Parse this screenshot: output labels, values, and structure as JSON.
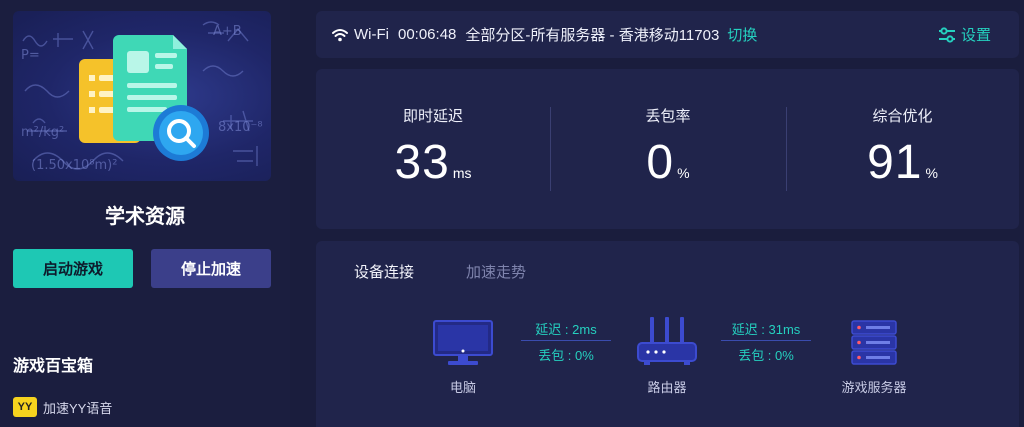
{
  "game": {
    "title": "学术资源",
    "start_button": "启动游戏",
    "stop_button": "停止加速"
  },
  "toolbox": {
    "title": "游戏百宝箱",
    "items": [
      {
        "logo": "yy",
        "label": "加速YY语音"
      }
    ]
  },
  "status": {
    "network": "Wi-Fi",
    "elapsed": "00:06:48",
    "region": "全部分区-所有服务器 - 香港移动11703",
    "switch_label": "切换",
    "settings_label": "设置"
  },
  "stats": {
    "latency": {
      "label": "即时延迟",
      "value": "33",
      "unit": "ms"
    },
    "loss": {
      "label": "丢包率",
      "value": "0",
      "unit": "%"
    },
    "optimization": {
      "label": "综合优化",
      "value": "91",
      "unit": "%"
    }
  },
  "tabs": [
    {
      "label": "设备连接",
      "active": true
    },
    {
      "label": "加速走势",
      "active": false
    }
  ],
  "connection": {
    "pc_label": "电脑",
    "router_label": "路由器",
    "server_label": "游戏服务器",
    "pc_to_router": {
      "latency": "延迟 : 2ms",
      "loss": "丢包 : 0%"
    },
    "router_to_server": {
      "latency": "延迟 : 31ms",
      "loss": "丢包 : 0%"
    }
  },
  "colors": {
    "accent": "#25d0bf",
    "background": "#1a1d3d",
    "panel": "#20244b",
    "stop_button": "#3b3f8a"
  }
}
